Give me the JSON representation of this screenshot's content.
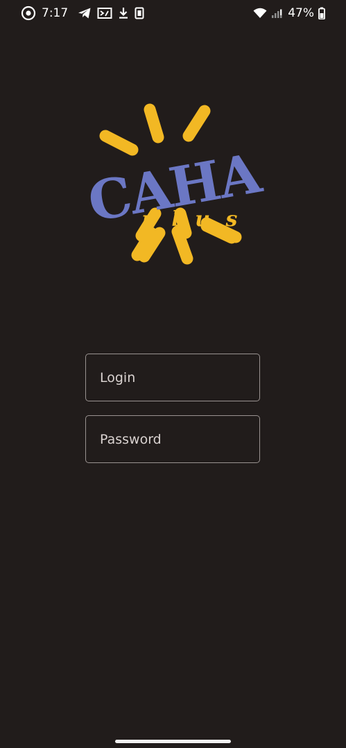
{
  "status_bar": {
    "time": "7:17",
    "battery_percent": "47%",
    "icons_left": [
      "record-icon",
      "telegram-icon",
      "screen-cast-icon",
      "download-icon",
      "sim-icon"
    ],
    "icons_right": [
      "wifi-icon",
      "cell-signal-icon",
      "battery-icon"
    ]
  },
  "logo": {
    "main_text": "CAHA",
    "sub_text": "p l u s",
    "colors": {
      "text_blue": "#6b77c4",
      "rays_yellow": "#f2b824"
    }
  },
  "form": {
    "login_placeholder": "Login",
    "password_placeholder": "Password"
  },
  "colors": {
    "background": "#211c1b",
    "field_border": "#9a9391",
    "placeholder_text": "#d9d2d0"
  }
}
